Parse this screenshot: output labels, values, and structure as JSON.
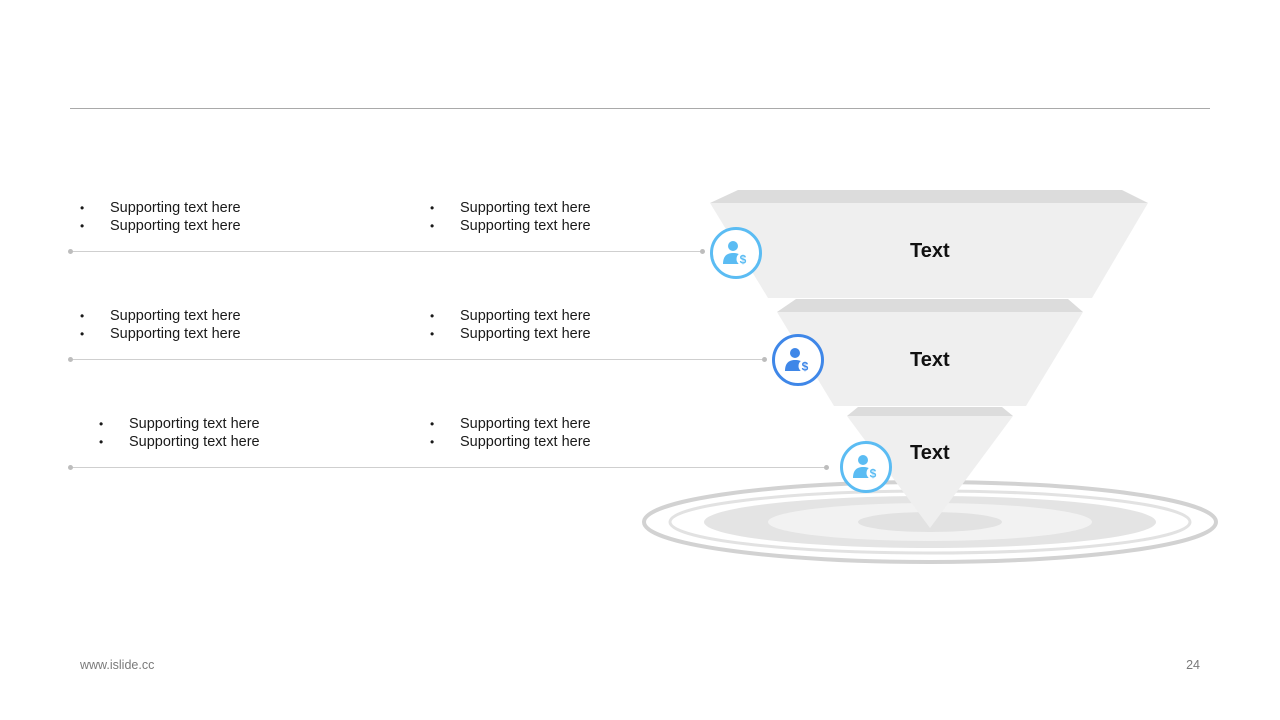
{
  "rows": [
    {
      "left_bullets": [
        "Supporting text here",
        "Supporting text here"
      ],
      "right_bullets": [
        "Supporting text here",
        "Supporting text here"
      ],
      "stage_label": "Text",
      "icon": "person-dollar-icon",
      "ring_color": "#5bbcf3"
    },
    {
      "left_bullets": [
        "Supporting text here",
        "Supporting text here"
      ],
      "right_bullets": [
        "Supporting text here",
        "Supporting text here"
      ],
      "stage_label": "Text",
      "icon": "person-dollar-icon",
      "ring_color": "#3f87e8"
    },
    {
      "left_bullets": [
        "Supporting text here",
        "Supporting text here"
      ],
      "right_bullets": [
        "Supporting text here",
        "Supporting text here"
      ],
      "stage_label": "Text",
      "icon": "person-dollar-icon",
      "ring_color": "#5bbcf3"
    }
  ],
  "footer": {
    "website": "www.islide.cc",
    "page_number": "24"
  },
  "colors": {
    "funnel_face": "#f0f0f0",
    "funnel_top": "#d9d9d9",
    "target_ring": "#d6d6d6",
    "connector": "#cfcfcf"
  }
}
